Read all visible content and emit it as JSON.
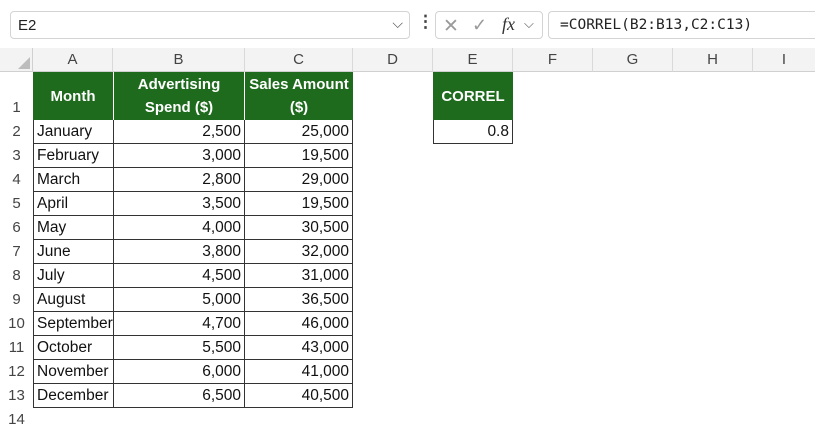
{
  "formula_bar": {
    "name_box": "E2",
    "fx_label": "fx",
    "formula": "=CORREL(B2:B13,C2:C13)"
  },
  "column_headers": [
    "A",
    "B",
    "C",
    "D",
    "E",
    "F",
    "G",
    "H",
    "I"
  ],
  "row_numbers": [
    "1",
    "2",
    "3",
    "4",
    "5",
    "6",
    "7",
    "8",
    "9",
    "10",
    "11",
    "12",
    "13",
    "14"
  ],
  "table": {
    "headers": {
      "month": "Month",
      "ad_spend": "Advertising Spend ($)",
      "sales": "Sales Amount ($)"
    },
    "rows": [
      {
        "month": "January",
        "spend": "2,500",
        "sales": "25,000"
      },
      {
        "month": "February",
        "spend": "3,000",
        "sales": "19,500"
      },
      {
        "month": "March",
        "spend": "2,800",
        "sales": "29,000"
      },
      {
        "month": "April",
        "spend": "3,500",
        "sales": "19,500"
      },
      {
        "month": "May",
        "spend": "4,000",
        "sales": "30,500"
      },
      {
        "month": "June",
        "spend": "3,800",
        "sales": "32,000"
      },
      {
        "month": "July",
        "spend": "4,500",
        "sales": "31,000"
      },
      {
        "month": "August",
        "spend": "5,000",
        "sales": "36,500"
      },
      {
        "month": "September",
        "spend": "4,700",
        "sales": "46,000"
      },
      {
        "month": "October",
        "spend": "5,500",
        "sales": "43,000"
      },
      {
        "month": "November",
        "spend": "6,000",
        "sales": "41,000"
      },
      {
        "month": "December",
        "spend": "6,500",
        "sales": "40,500"
      }
    ]
  },
  "correl": {
    "header": "CORREL",
    "value": "0.8"
  },
  "colors": {
    "header_fill": "#1e6b1d",
    "header_text": "#ffffff"
  }
}
